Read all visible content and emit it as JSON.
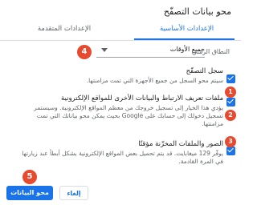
{
  "dialog": {
    "title": "محو بيانات التصفّح"
  },
  "tabs": [
    {
      "label": "الإعدادات الأساسية"
    },
    {
      "label": "الإعدادات المتقدمة"
    }
  ],
  "time_range": {
    "label": "النطاق الزمني",
    "selected": "جميع الأوقات"
  },
  "items": [
    {
      "title": "سجل التصفّح",
      "description": "سيتم محو السجل من جميع الأجهزة التي تمت مزامنتها.",
      "checked": true,
      "badge": "1"
    },
    {
      "title": "ملفات تعريف الارتباط والبيانات الأخرى للمواقع الإلكترونية",
      "description_lines": [
        "يؤدي هذا الخيار إلى تسجيل خروجك من معظم المواقع الإلكترونية. وسيستمر",
        "تسجيل دخولك إلى حسابك على Google بحيث يمكن محو بياناتك التي تمت",
        "مزامنتها."
      ],
      "checked": true,
      "badge": "2"
    },
    {
      "title": "الصور والملفات المخزّنة مؤقتًا",
      "description_lines": [
        "يوفّر 129 ميغابايت. قد يتم تحميل بعض المواقع الإلكترونية بشكل أبطأ عند زيارتها",
        "في المرة القادمة."
      ],
      "checked": true,
      "badge": "3"
    }
  ],
  "markers": {
    "time_range_badge": "4",
    "clear_badge": "5"
  },
  "buttons": {
    "clear": "محو البيانات",
    "cancel": "إلغاء"
  },
  "colors": {
    "accent": "#1a73e8",
    "badge": "#e84a2f"
  }
}
